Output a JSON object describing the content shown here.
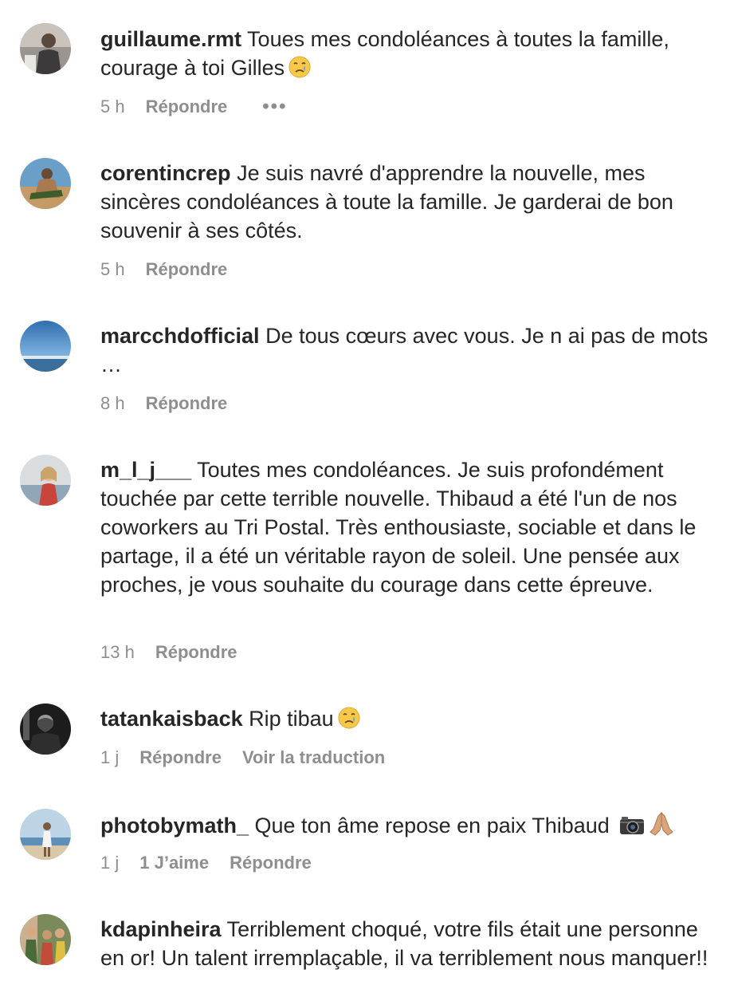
{
  "comments": [
    {
      "username": "guillaume.rmt",
      "text": "Toues mes condoléances à toutes la famille, courage à toi Gilles",
      "emoji": "crying-face",
      "time": "5 h",
      "reply": "Répondre",
      "more": "•••"
    },
    {
      "username": "corentincrep",
      "text": "Je suis navré d'apprendre la nouvelle, mes sincères condoléances à toute la famille. Je garderai de bon souvenir à ses côtés.",
      "time": "5 h",
      "reply": "Répondre"
    },
    {
      "username": "marcchdofficial",
      "text": "De tous cœurs avec vous. Je n ai pas de mots …",
      "time": "8 h",
      "reply": "Répondre"
    },
    {
      "username": "m_l_j___",
      "text": "Toutes mes condoléances. Je suis profondément touchée par cette terrible nouvelle. Thibaud a été l'un de nos coworkers au Tri Postal. Très enthousiaste, sociable et dans le partage, il a été un véritable rayon de soleil. Une pensée aux proches, je vous souhaite du courage dans cette épreuve.",
      "time": "13 h",
      "reply": "Répondre"
    },
    {
      "username": "tatankaisback",
      "text": "Rip tibau",
      "emoji": "crying-face",
      "time": "1 j",
      "reply": "Répondre",
      "translate": "Voir la traduction"
    },
    {
      "username": "photobymath_",
      "text": "Que ton âme repose en paix Thibaud",
      "emoji": "camera, folded-hands",
      "time": "1 j",
      "likes": "1 J’aime",
      "reply": "Répondre"
    },
    {
      "username": "kdapinheira",
      "text": "Terriblement choqué, votre fils était une personne en or! Un talent irremplaçable, il va terriblement nous manquer!!"
    }
  ]
}
